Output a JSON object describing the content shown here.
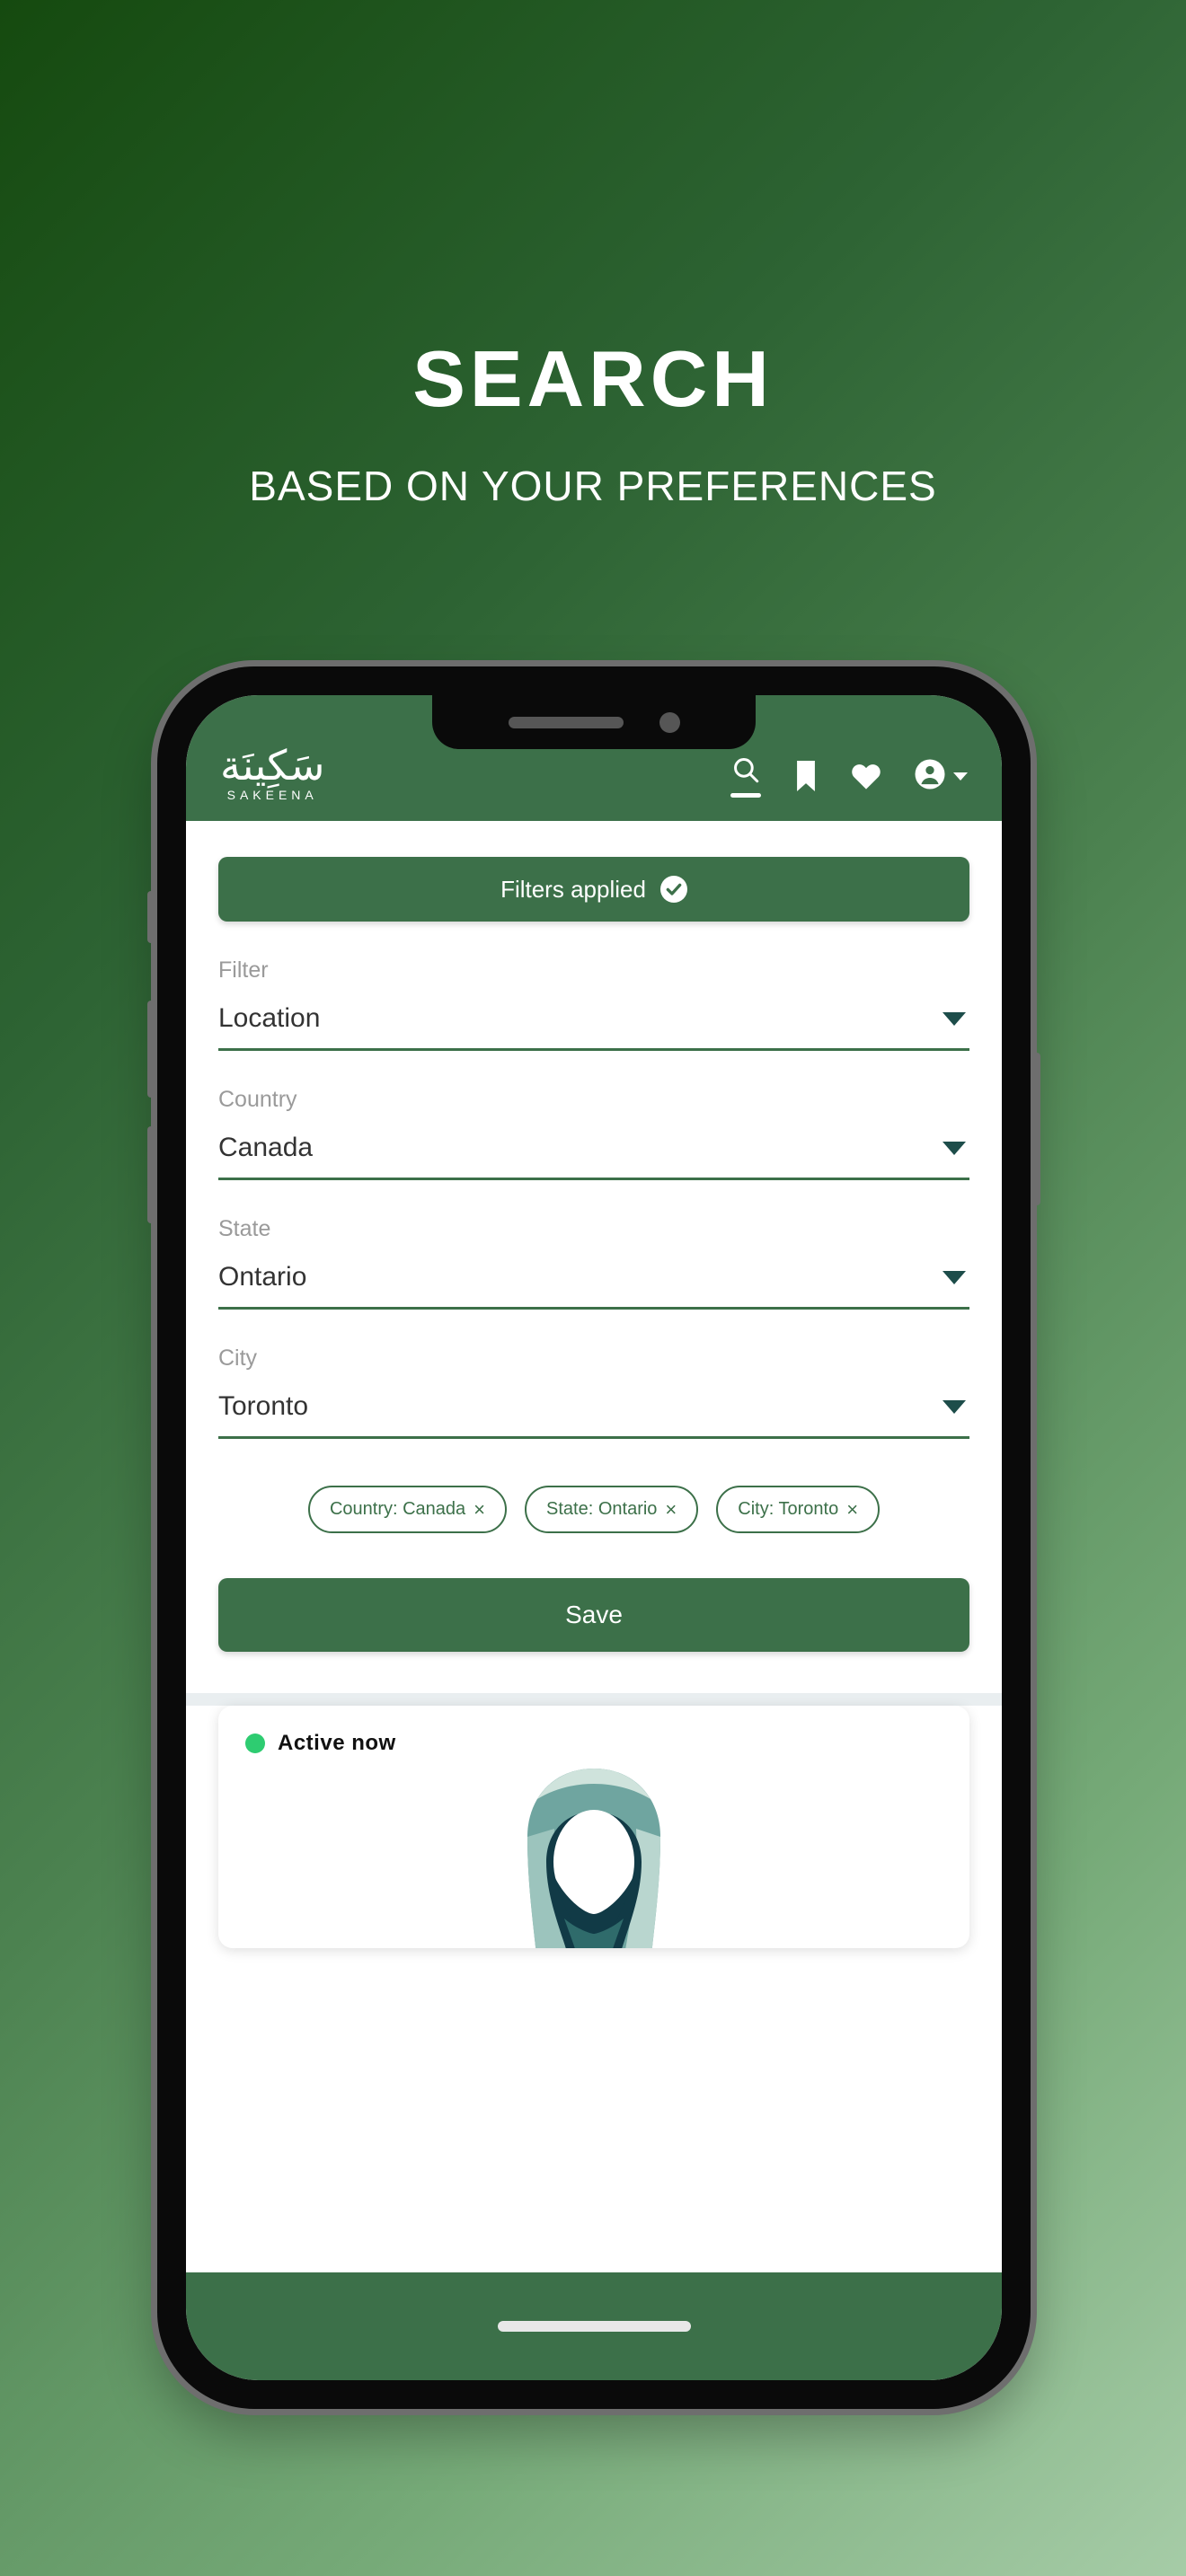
{
  "promo": {
    "title": "SEARCH",
    "subtitle": "BASED ON YOUR PREFERENCES"
  },
  "colors": {
    "brand_green": "#3c7049",
    "bg_gradient_start": "#154a0f",
    "bg_gradient_end": "#a6cca7",
    "active_dot": "#2ecc71",
    "caret": "#1d4d4a"
  },
  "app": {
    "brand": {
      "arabic": "سَكِينَة",
      "latin": "SAKEENA"
    },
    "header_icons": [
      {
        "name": "search-icon",
        "active": true
      },
      {
        "name": "bookmark-icon",
        "active": false
      },
      {
        "name": "heart-icon",
        "active": false
      },
      {
        "name": "account-icon",
        "active": false
      }
    ],
    "filters_applied": {
      "label": "Filters applied",
      "icon": "check-circle-icon"
    },
    "fields": [
      {
        "label": "Filter",
        "value": "Location"
      },
      {
        "label": "Country",
        "value": "Canada"
      },
      {
        "label": "State",
        "value": "Ontario"
      },
      {
        "label": "City",
        "value": "Toronto"
      }
    ],
    "chips": [
      {
        "label": "Country: Canada",
        "remove": "×"
      },
      {
        "label": "State: Ontario",
        "remove": "×"
      },
      {
        "label": "City: Toronto",
        "remove": "×"
      }
    ],
    "save_label": "Save",
    "profile_card": {
      "status": "Active now",
      "avatar": "hijab-woman-illustration"
    }
  }
}
